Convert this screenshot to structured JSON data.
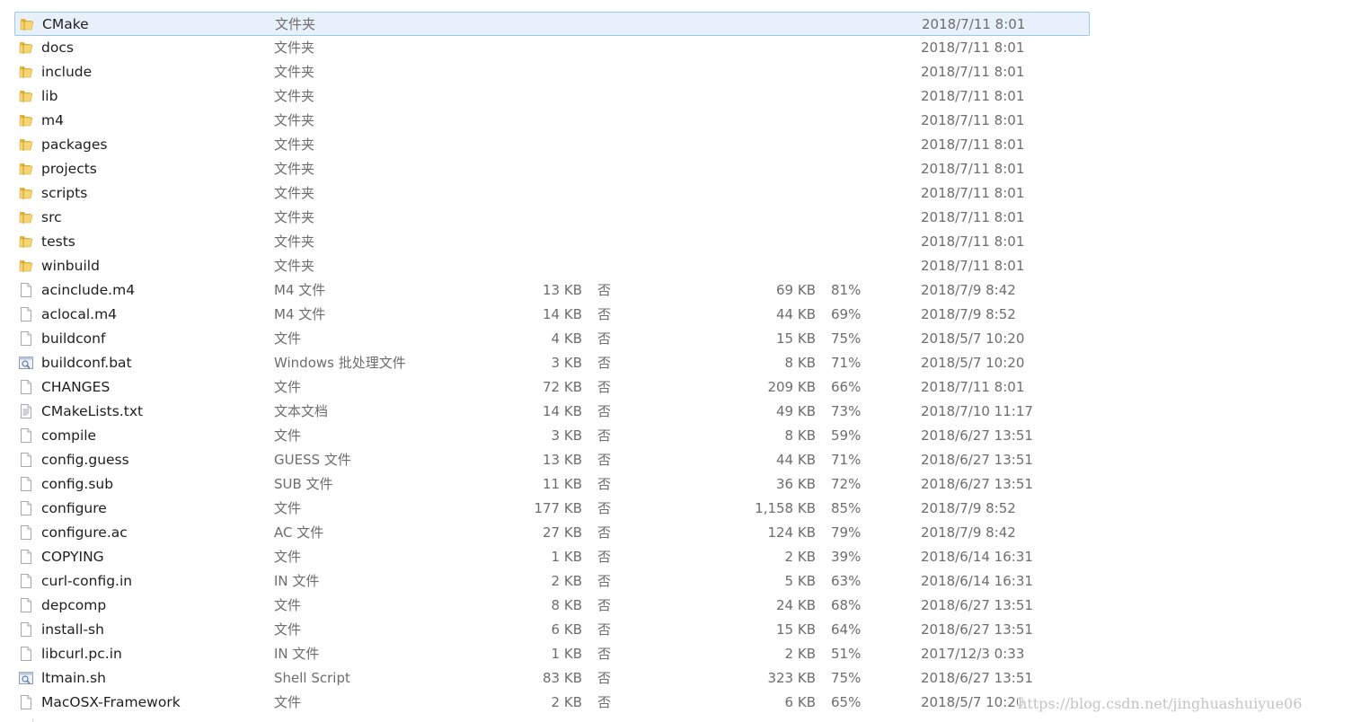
{
  "files": [
    {
      "name": "CMake",
      "type": "文件夹",
      "size": "",
      "encrypted": "",
      "packed_size": "",
      "ratio": "",
      "modified": "2018/7/11 8:01",
      "icon": "folder-icon",
      "selected": true
    },
    {
      "name": "docs",
      "type": "文件夹",
      "size": "",
      "encrypted": "",
      "packed_size": "",
      "ratio": "",
      "modified": "2018/7/11 8:01",
      "icon": "folder-icon"
    },
    {
      "name": "include",
      "type": "文件夹",
      "size": "",
      "encrypted": "",
      "packed_size": "",
      "ratio": "",
      "modified": "2018/7/11 8:01",
      "icon": "folder-icon"
    },
    {
      "name": "lib",
      "type": "文件夹",
      "size": "",
      "encrypted": "",
      "packed_size": "",
      "ratio": "",
      "modified": "2018/7/11 8:01",
      "icon": "folder-icon"
    },
    {
      "name": "m4",
      "type": "文件夹",
      "size": "",
      "encrypted": "",
      "packed_size": "",
      "ratio": "",
      "modified": "2018/7/11 8:01",
      "icon": "folder-icon"
    },
    {
      "name": "packages",
      "type": "文件夹",
      "size": "",
      "encrypted": "",
      "packed_size": "",
      "ratio": "",
      "modified": "2018/7/11 8:01",
      "icon": "folder-icon"
    },
    {
      "name": "projects",
      "type": "文件夹",
      "size": "",
      "encrypted": "",
      "packed_size": "",
      "ratio": "",
      "modified": "2018/7/11 8:01",
      "icon": "folder-icon"
    },
    {
      "name": "scripts",
      "type": "文件夹",
      "size": "",
      "encrypted": "",
      "packed_size": "",
      "ratio": "",
      "modified": "2018/7/11 8:01",
      "icon": "folder-icon"
    },
    {
      "name": "src",
      "type": "文件夹",
      "size": "",
      "encrypted": "",
      "packed_size": "",
      "ratio": "",
      "modified": "2018/7/11 8:01",
      "icon": "folder-icon"
    },
    {
      "name": "tests",
      "type": "文件夹",
      "size": "",
      "encrypted": "",
      "packed_size": "",
      "ratio": "",
      "modified": "2018/7/11 8:01",
      "icon": "folder-icon"
    },
    {
      "name": "winbuild",
      "type": "文件夹",
      "size": "",
      "encrypted": "",
      "packed_size": "",
      "ratio": "",
      "modified": "2018/7/11 8:01",
      "icon": "folder-icon"
    },
    {
      "name": "acinclude.m4",
      "type": "M4 文件",
      "size": "13 KB",
      "encrypted": "否",
      "packed_size": "69 KB",
      "ratio": "81%",
      "modified": "2018/7/9 8:42",
      "icon": "file-icon"
    },
    {
      "name": "aclocal.m4",
      "type": "M4 文件",
      "size": "14 KB",
      "encrypted": "否",
      "packed_size": "44 KB",
      "ratio": "69%",
      "modified": "2018/7/9 8:52",
      "icon": "file-icon"
    },
    {
      "name": "buildconf",
      "type": "文件",
      "size": "4 KB",
      "encrypted": "否",
      "packed_size": "15 KB",
      "ratio": "75%",
      "modified": "2018/5/7 10:20",
      "icon": "file-icon"
    },
    {
      "name": "buildconf.bat",
      "type": "Windows 批处理文件",
      "size": "3 KB",
      "encrypted": "否",
      "packed_size": "8 KB",
      "ratio": "71%",
      "modified": "2018/5/7 10:20",
      "icon": "batch-file-icon"
    },
    {
      "name": "CHANGES",
      "type": "文件",
      "size": "72 KB",
      "encrypted": "否",
      "packed_size": "209 KB",
      "ratio": "66%",
      "modified": "2018/7/11 8:01",
      "icon": "file-icon"
    },
    {
      "name": "CMakeLists.txt",
      "type": "文本文档",
      "size": "14 KB",
      "encrypted": "否",
      "packed_size": "49 KB",
      "ratio": "73%",
      "modified": "2018/7/10 11:17",
      "icon": "text-file-icon"
    },
    {
      "name": "compile",
      "type": "文件",
      "size": "3 KB",
      "encrypted": "否",
      "packed_size": "8 KB",
      "ratio": "59%",
      "modified": "2018/6/27 13:51",
      "icon": "file-icon"
    },
    {
      "name": "config.guess",
      "type": "GUESS 文件",
      "size": "13 KB",
      "encrypted": "否",
      "packed_size": "44 KB",
      "ratio": "71%",
      "modified": "2018/6/27 13:51",
      "icon": "file-icon"
    },
    {
      "name": "config.sub",
      "type": "SUB 文件",
      "size": "11 KB",
      "encrypted": "否",
      "packed_size": "36 KB",
      "ratio": "72%",
      "modified": "2018/6/27 13:51",
      "icon": "file-icon"
    },
    {
      "name": "configure",
      "type": "文件",
      "size": "177 KB",
      "encrypted": "否",
      "packed_size": "1,158 KB",
      "ratio": "85%",
      "modified": "2018/7/9 8:52",
      "icon": "file-icon"
    },
    {
      "name": "configure.ac",
      "type": "AC 文件",
      "size": "27 KB",
      "encrypted": "否",
      "packed_size": "124 KB",
      "ratio": "79%",
      "modified": "2018/7/9 8:42",
      "icon": "file-icon"
    },
    {
      "name": "COPYING",
      "type": "文件",
      "size": "1 KB",
      "encrypted": "否",
      "packed_size": "2 KB",
      "ratio": "39%",
      "modified": "2018/6/14 16:31",
      "icon": "file-icon"
    },
    {
      "name": "curl-config.in",
      "type": "IN 文件",
      "size": "2 KB",
      "encrypted": "否",
      "packed_size": "5 KB",
      "ratio": "63%",
      "modified": "2018/6/14 16:31",
      "icon": "file-icon"
    },
    {
      "name": "depcomp",
      "type": "文件",
      "size": "8 KB",
      "encrypted": "否",
      "packed_size": "24 KB",
      "ratio": "68%",
      "modified": "2018/6/27 13:51",
      "icon": "file-icon"
    },
    {
      "name": "install-sh",
      "type": "文件",
      "size": "6 KB",
      "encrypted": "否",
      "packed_size": "15 KB",
      "ratio": "64%",
      "modified": "2018/6/27 13:51",
      "icon": "file-icon"
    },
    {
      "name": "libcurl.pc.in",
      "type": "IN 文件",
      "size": "1 KB",
      "encrypted": "否",
      "packed_size": "2 KB",
      "ratio": "51%",
      "modified": "2017/12/3 0:33",
      "icon": "file-icon"
    },
    {
      "name": "ltmain.sh",
      "type": "Shell Script",
      "size": "83 KB",
      "encrypted": "否",
      "packed_size": "323 KB",
      "ratio": "75%",
      "modified": "2018/6/27 13:51",
      "icon": "script-file-icon"
    },
    {
      "name": "MacOSX-Framework",
      "type": "文件",
      "size": "2 KB",
      "encrypted": "否",
      "packed_size": "6 KB",
      "ratio": "65%",
      "modified": "2018/5/7 10:20",
      "icon": "file-icon"
    }
  ],
  "watermark": "https://blog.csdn.net/jinghuashuiyue06",
  "colors": {
    "selection_bg": "#e8f1fb",
    "selection_border": "#99c9ef",
    "folder": "#f0c94c",
    "text": "#1e1e1e",
    "muted": "#6d6d6d"
  }
}
